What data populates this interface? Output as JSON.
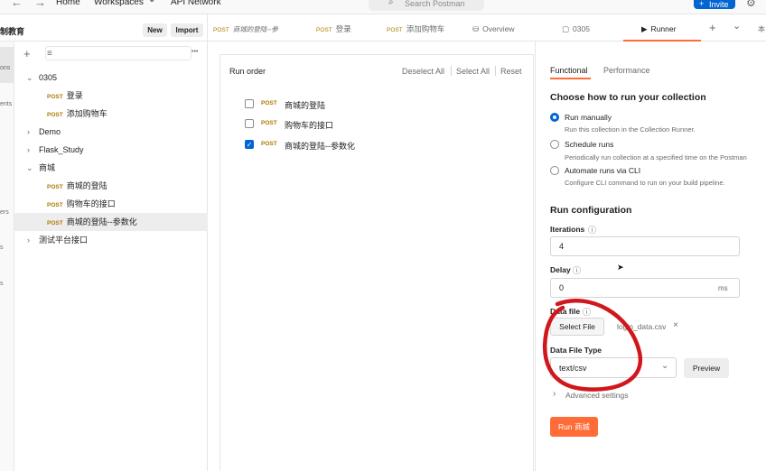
{
  "topbar": {
    "back": "←",
    "forward": "→",
    "home": "Home",
    "workspaces": "Workspaces",
    "workspaces_chevron": "⌄",
    "api_network": "API Network",
    "search_placeholder": "Search Postman",
    "invite": "Invite",
    "search_icon": "⌕",
    "invite_icon": "+",
    "gear_icon": "⚙"
  },
  "rail": {
    "items": [
      "ons",
      "ents",
      "ers",
      "s",
      "s"
    ]
  },
  "workspace": {
    "name": "制教育",
    "new_label": "New",
    "import_label": "Import",
    "add": "+",
    "filter_icon": "≡",
    "more": "•••"
  },
  "tree": [
    {
      "type": "folder",
      "label": "0305",
      "expanded": true,
      "chev": "⌄"
    },
    {
      "type": "request",
      "method": "POST",
      "label": "登录"
    },
    {
      "type": "request",
      "method": "POST",
      "label": "添加购物车"
    },
    {
      "type": "folder",
      "label": "Demo",
      "expanded": false,
      "chev": "›"
    },
    {
      "type": "folder",
      "label": "Flask_Study",
      "expanded": false,
      "chev": "›"
    },
    {
      "type": "folder",
      "label": "商城",
      "expanded": true,
      "chev": "⌄"
    },
    {
      "type": "request",
      "method": "POST",
      "label": "商城的登陆"
    },
    {
      "type": "request",
      "method": "POST",
      "label": "购物车的接口"
    },
    {
      "type": "request",
      "method": "POST",
      "label": "商城的登陆--参数化",
      "selected": true
    },
    {
      "type": "folder",
      "label": "测试平台接口",
      "expanded": false,
      "chev": "›"
    }
  ],
  "tabs": [
    {
      "method": "POST",
      "label": "商城的登陆--参"
    },
    {
      "method": "POST",
      "label": "登录"
    },
    {
      "method": "POST",
      "label": "添加购物车"
    },
    {
      "icon": "⛁",
      "label": "Overview"
    },
    {
      "icon": "▢",
      "label": "0305"
    },
    {
      "icon": "▶",
      "label": "Runner",
      "active": true
    }
  ],
  "tab_controls": {
    "add": "+",
    "chevron": "⌄",
    "env": "本"
  },
  "run_order": {
    "title": "Run order",
    "deselect_all": "Deselect All",
    "select_all": "Select All",
    "reset": "Reset",
    "items": [
      {
        "method": "POST",
        "label": "商城的登陆",
        "checked": false
      },
      {
        "method": "POST",
        "label": "购物车的接口",
        "checked": false
      },
      {
        "method": "POST",
        "label": "商城的登陆--参数化",
        "checked": true
      }
    ],
    "check_mark": "✓"
  },
  "config": {
    "tab_functional": "Functional",
    "tab_performance": "Performance",
    "how_title": "Choose how to run your collection",
    "options": [
      {
        "label": "Run manually",
        "desc": "Run this collection in the Collection Runner.",
        "checked": true
      },
      {
        "label": "Schedule runs",
        "desc": "Periodically run collection at a specified time on the Postman",
        "checked": false
      },
      {
        "label": "Automate runs via CLI",
        "desc": "Configure CLI command to run on your build pipeline.",
        "checked": false
      }
    ],
    "run_config_title": "Run configuration",
    "iterations_label": "Iterations",
    "iterations_value": "4",
    "delay_label": "Delay",
    "delay_value": "0",
    "delay_unit": "ms",
    "info_icon": "ⓘ",
    "data_file_label": "Data file",
    "select_file": "Select File",
    "file_name": "login_data.csv",
    "remove_file": "×",
    "data_file_type_label": "Data File Type",
    "data_file_type_value": "text/csv",
    "select_chevron": "⌄",
    "preview": "Preview",
    "advanced": "Advanced settings",
    "advanced_chev": "›",
    "run_button": "Run 商城"
  },
  "colors": {
    "accent": "#ff6c37",
    "primary": "#0265d2",
    "post": "#ad7a03",
    "annotation": "#d0171c"
  }
}
